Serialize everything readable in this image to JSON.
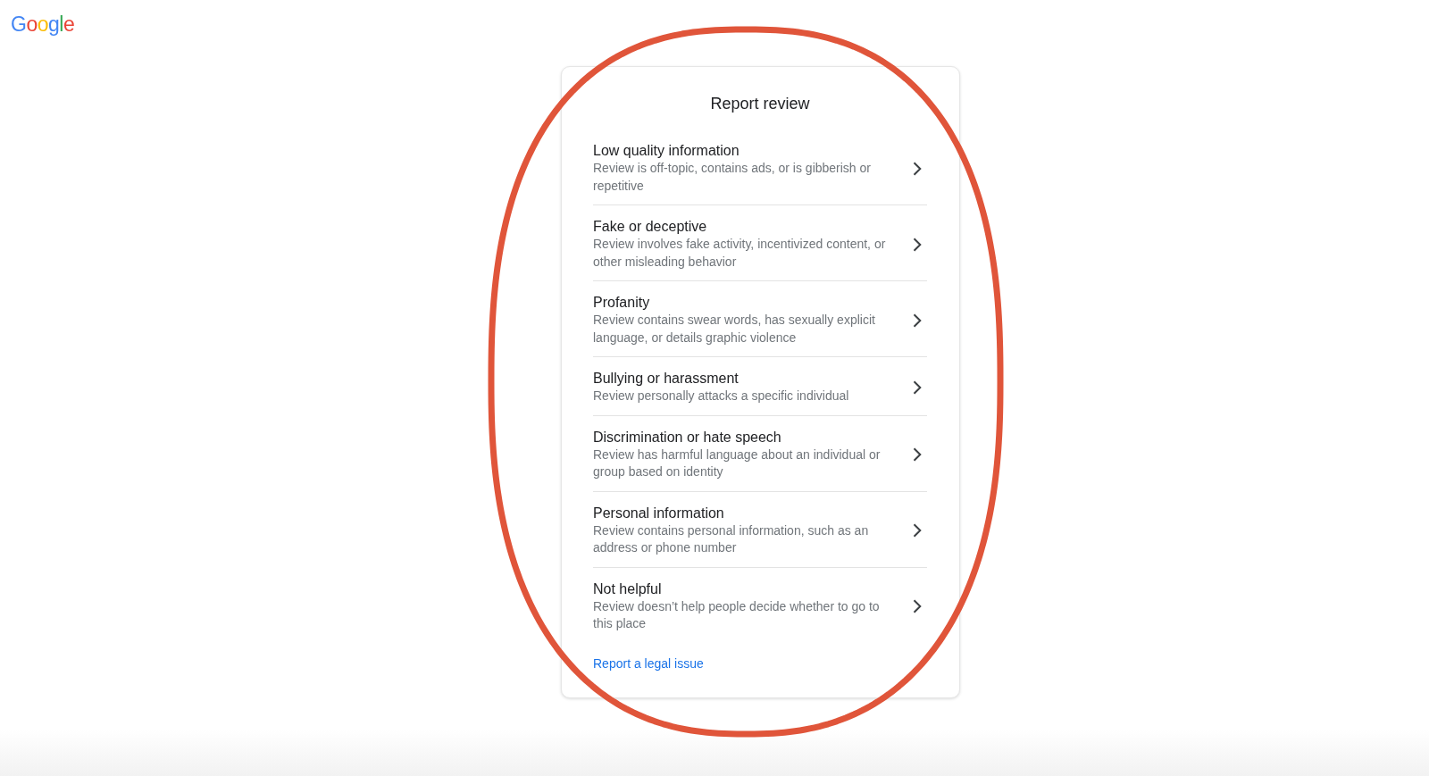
{
  "logo": {
    "text": "Google"
  },
  "dialog": {
    "title": "Report review",
    "options": [
      {
        "title": "Low quality information",
        "description": "Review is off-topic, contains ads, or is gibberish or repetitive"
      },
      {
        "title": "Fake or deceptive",
        "description": "Review involves fake activity, incentivized content, or other misleading behavior"
      },
      {
        "title": "Profanity",
        "description": "Review contains swear words, has sexually explicit language, or details graphic violence"
      },
      {
        "title": "Bullying or harassment",
        "description": "Review personally attacks a specific individual"
      },
      {
        "title": "Discrimination or hate speech",
        "description": "Review has harmful language about an individual or group based on identity"
      },
      {
        "title": "Personal information",
        "description": "Review contains personal information, such as an address or phone number"
      },
      {
        "title": "Not helpful",
        "description": "Review doesn’t help people decide whether to go to this place"
      }
    ],
    "link": "Report a legal issue"
  },
  "annotation": {
    "kind": "ellipse"
  }
}
